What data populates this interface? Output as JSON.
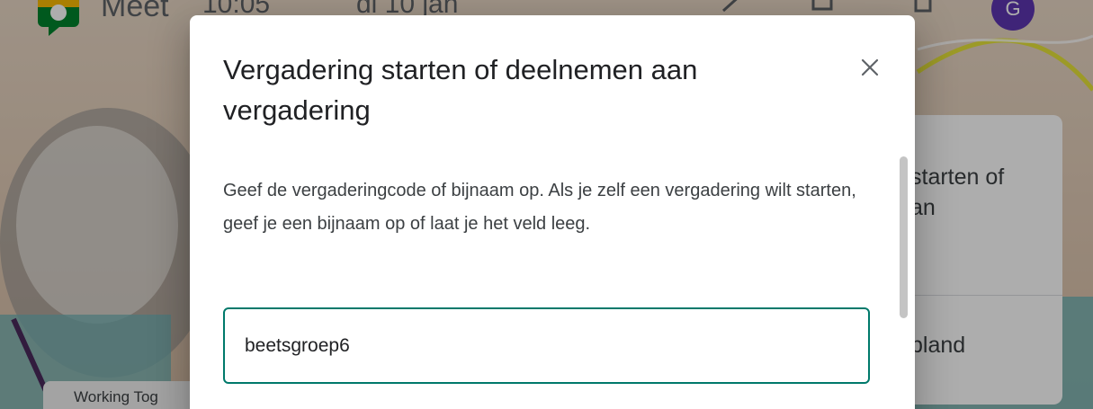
{
  "background": {
    "app_name": "Meet",
    "time": "10:05",
    "date": "di 10 jan",
    "avatar_initial": "G",
    "right_card": {
      "line1": "starten of",
      "line2": "an",
      "line3": "pland"
    },
    "chip_label": "Working Tog"
  },
  "dialog": {
    "title": "Vergadering starten of deelnemen aan vergadering",
    "body": "Geef de vergaderingcode of bijnaam op. Als je zelf een vergadering wilt starten, geef je een bijnaam op of laat je het veld leeg.",
    "input_value": "beetsgroep6",
    "close_icon": "close-icon"
  },
  "colors": {
    "accent": "#00796b",
    "avatar": "#5e35b1",
    "scrim": "rgba(0,0,0,0.32)"
  }
}
